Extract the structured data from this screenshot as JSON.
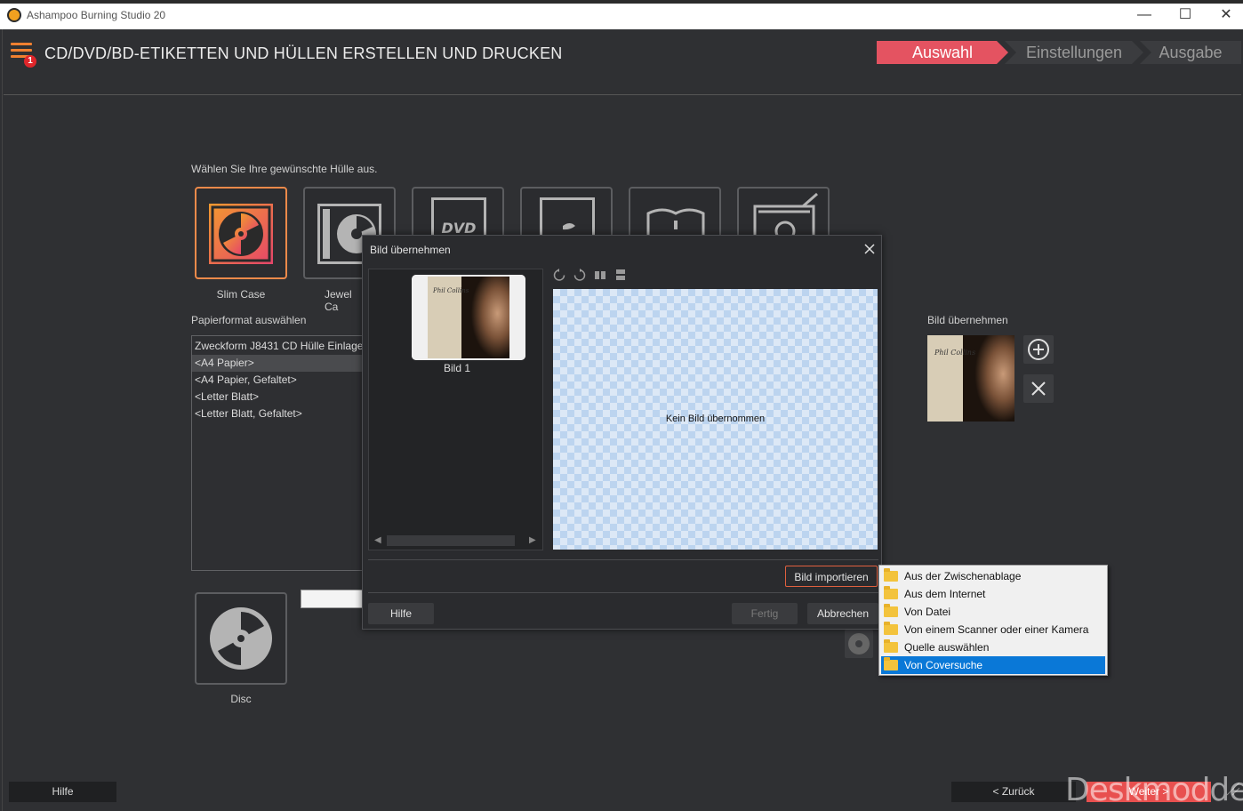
{
  "window": {
    "title": "Ashampoo Burning Studio 20",
    "minimize": "—",
    "maximize": "☐",
    "close": "✕"
  },
  "header": {
    "title": "CD/DVD/BD-ETIKETTEN UND HÜLLEN ERSTELLEN UND DRUCKEN",
    "badge": "1",
    "steps": [
      "Auswahl",
      "Einstellungen",
      "Ausgabe"
    ],
    "active_step": "Auswahl"
  },
  "case_section": {
    "prompt": "Wählen Sie Ihre gewünschte Hülle aus.",
    "tiles": [
      {
        "label": "Slim Case",
        "selected": true,
        "icon": "slim-case-icon"
      },
      {
        "label": "Jewel Ca",
        "icon": "jewel-case-icon"
      },
      {
        "label": "",
        "icon": "dvd-case-icon",
        "icon_text": "DVD"
      },
      {
        "label": "",
        "icon": "bluray-case-icon"
      },
      {
        "label": "",
        "icon": "booklet-icon"
      },
      {
        "label": "",
        "icon": "sleeve-icon"
      }
    ]
  },
  "paper": {
    "label": "Papierformat auswählen",
    "items": [
      "Zweckform J8431 CD Hülle Einlage",
      "<A4 Papier>",
      "<A4 Papier, Gefaltet>",
      "<Letter Blatt>",
      "<Letter Blatt, Gefaltet>"
    ],
    "selected_index": 1
  },
  "disc": {
    "label": "Disc",
    "icon": "disc-icon"
  },
  "right_panel": {
    "label": "Bild übernehmen",
    "add_icon": "plus-circle-icon",
    "remove_icon": "close-icon"
  },
  "dialog": {
    "title": "Bild übernehmen",
    "thumb_label": "Bild 1",
    "thumb_caption": "Phil Collins",
    "canvas_text": "Kein Bild übernommen",
    "tools": [
      "rotate-left-icon",
      "rotate-right-icon",
      "flip-horizontal-icon",
      "flip-vertical-icon"
    ],
    "import_button": "Bild importieren",
    "help_button": "Hilfe",
    "done_button": "Fertig",
    "cancel_button": "Abbrechen"
  },
  "import_menu": {
    "items": [
      "Aus der Zwischenablage",
      "Aus dem Internet",
      "Von Datei",
      "Von einem Scanner oder einer Kamera",
      "Quelle auswählen",
      "Von Coversuche"
    ],
    "highlighted_index": 5
  },
  "footer": {
    "help": "Hilfe",
    "back": "< Zurück",
    "next": "Weiter >"
  },
  "watermark": "Deskmodder.de",
  "colors": {
    "accent": "#e45361",
    "orange": "#ee8a4a",
    "menu_highlight": "#0a78d7",
    "background": "#2f3033"
  }
}
